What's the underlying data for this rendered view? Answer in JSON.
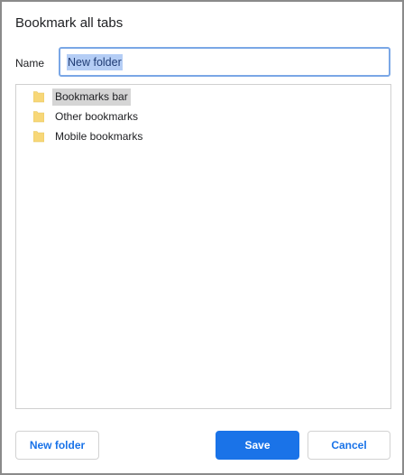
{
  "dialog": {
    "title": "Bookmark all tabs"
  },
  "name_field": {
    "label": "Name",
    "value": "New folder"
  },
  "folder_tree": {
    "items": [
      {
        "label": "Bookmarks bar",
        "icon": "folder-icon",
        "selected": true
      },
      {
        "label": "Other bookmarks",
        "icon": "folder-icon",
        "selected": false
      },
      {
        "label": "Mobile bookmarks",
        "icon": "folder-icon",
        "selected": false
      }
    ]
  },
  "buttons": {
    "new_folder": "New folder",
    "save": "Save",
    "cancel": "Cancel"
  },
  "colors": {
    "accent": "#1a73e8",
    "folder_fill": "#f7d778",
    "selection": "#d5d5d5"
  }
}
